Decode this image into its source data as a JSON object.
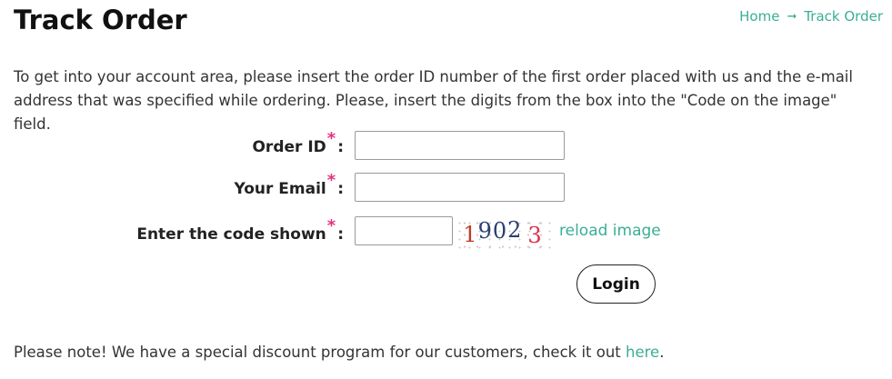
{
  "page": {
    "title": "Track Order"
  },
  "breadcrumb": {
    "home": "Home",
    "current": "Track Order"
  },
  "intro_text": "To get into your account area, please insert the order ID number of the first order placed with us and the e-mail address that was specified while ordering. Please, insert the digits from the box into the \"Code on the image\" field.",
  "form": {
    "order_id_label": "Order ID",
    "email_label": "Your Email",
    "code_label": "Enter the code shown",
    "required_mark": "*",
    "colon": ":",
    "order_id_value": "",
    "email_value": "",
    "code_value": "",
    "captcha_digits": [
      "1",
      "9",
      "0",
      "2",
      "3"
    ],
    "reload_link": "reload image",
    "submit_label": "Login"
  },
  "footer_note": {
    "text": "Please note! We have a special discount program for our customers, check it out ",
    "link": "here",
    "end": "."
  },
  "colors": {
    "accent": "#3aae95",
    "required": "#e2337e"
  }
}
